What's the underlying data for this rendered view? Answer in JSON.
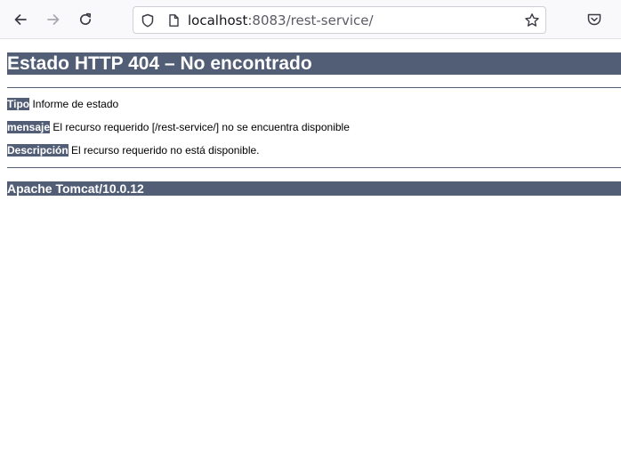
{
  "browser": {
    "url_host": "localhost",
    "url_rest": ":8083/rest-service/"
  },
  "page": {
    "heading": "Estado HTTP 404 – No encontrado",
    "rows": [
      {
        "label": "Tipo",
        "text": " Informe de estado"
      },
      {
        "label": "mensaje",
        "text": " El recurso requerido [/rest-service/] no se encuentra disponible"
      },
      {
        "label": "Descripción",
        "text": " El recurso requerido no está disponible."
      }
    ],
    "footer": "Apache Tomcat/10.0.12"
  },
  "colors": {
    "tomcat_bar": "#525d76",
    "toolbar_bg": "#f9f9fb"
  },
  "icons": {
    "back": "arrow-left-icon",
    "forward": "arrow-right-icon",
    "reload": "reload-icon",
    "shield": "shield-icon",
    "page": "page-icon",
    "bookmark": "star-icon",
    "pocket": "pocket-icon"
  }
}
